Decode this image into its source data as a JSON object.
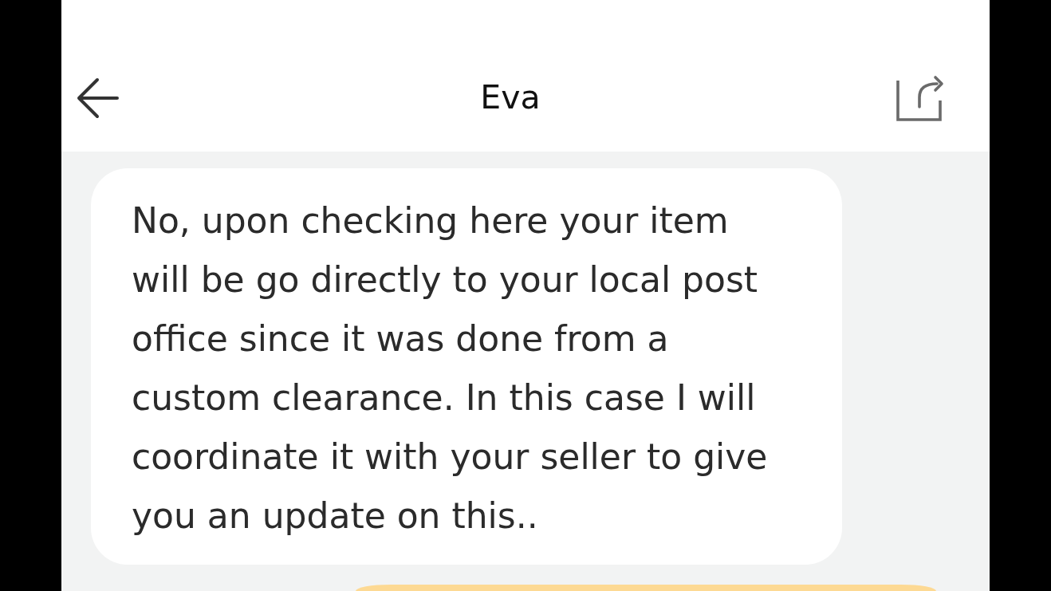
{
  "header": {
    "title": "Eva"
  },
  "messages": [
    {
      "kind": "incoming",
      "text": "No, upon checking here your item will be go directly to your local post office since it was done from a custom clearance. In this case I will coordinate it with your seller to give you an update on this.."
    },
    {
      "kind": "outgoing"
    }
  ]
}
